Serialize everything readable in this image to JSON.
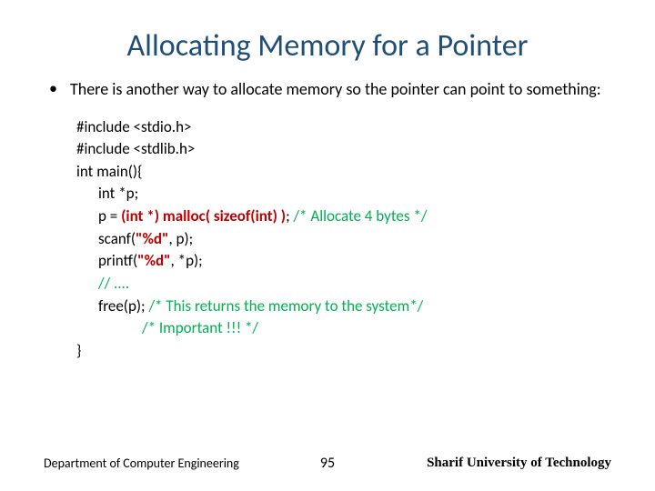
{
  "title": "Allocating Memory for a Pointer",
  "bullet_text": "There is another way to allocate memory so the pointer can point to something:",
  "code": {
    "l1": "#include <stdio.h>",
    "l2": "#include <stdlib.h>",
    "l3": "int main(){",
    "l4": "int *p;",
    "l5a": "p = ",
    "l5b": "(int *) malloc( sizeof(int) )",
    "l5c": ";   ",
    "l5d": "/* Allocate 4 bytes */",
    "l6a": "scanf(",
    "l6b": "\"%d\"",
    "l6c": ", p);",
    "l7a": "printf(",
    "l7b": "\"%d\"",
    "l7c": ", *p);",
    "l8": "// ....",
    "l9a": "free(p);      ",
    "l9b": "/* This returns the memory to the system*/",
    "l10": "/* Important !!! */",
    "l11": "}"
  },
  "footer": {
    "left": "Department of Computer Engineering",
    "center": "95",
    "right": "Sharif University of Technology"
  }
}
